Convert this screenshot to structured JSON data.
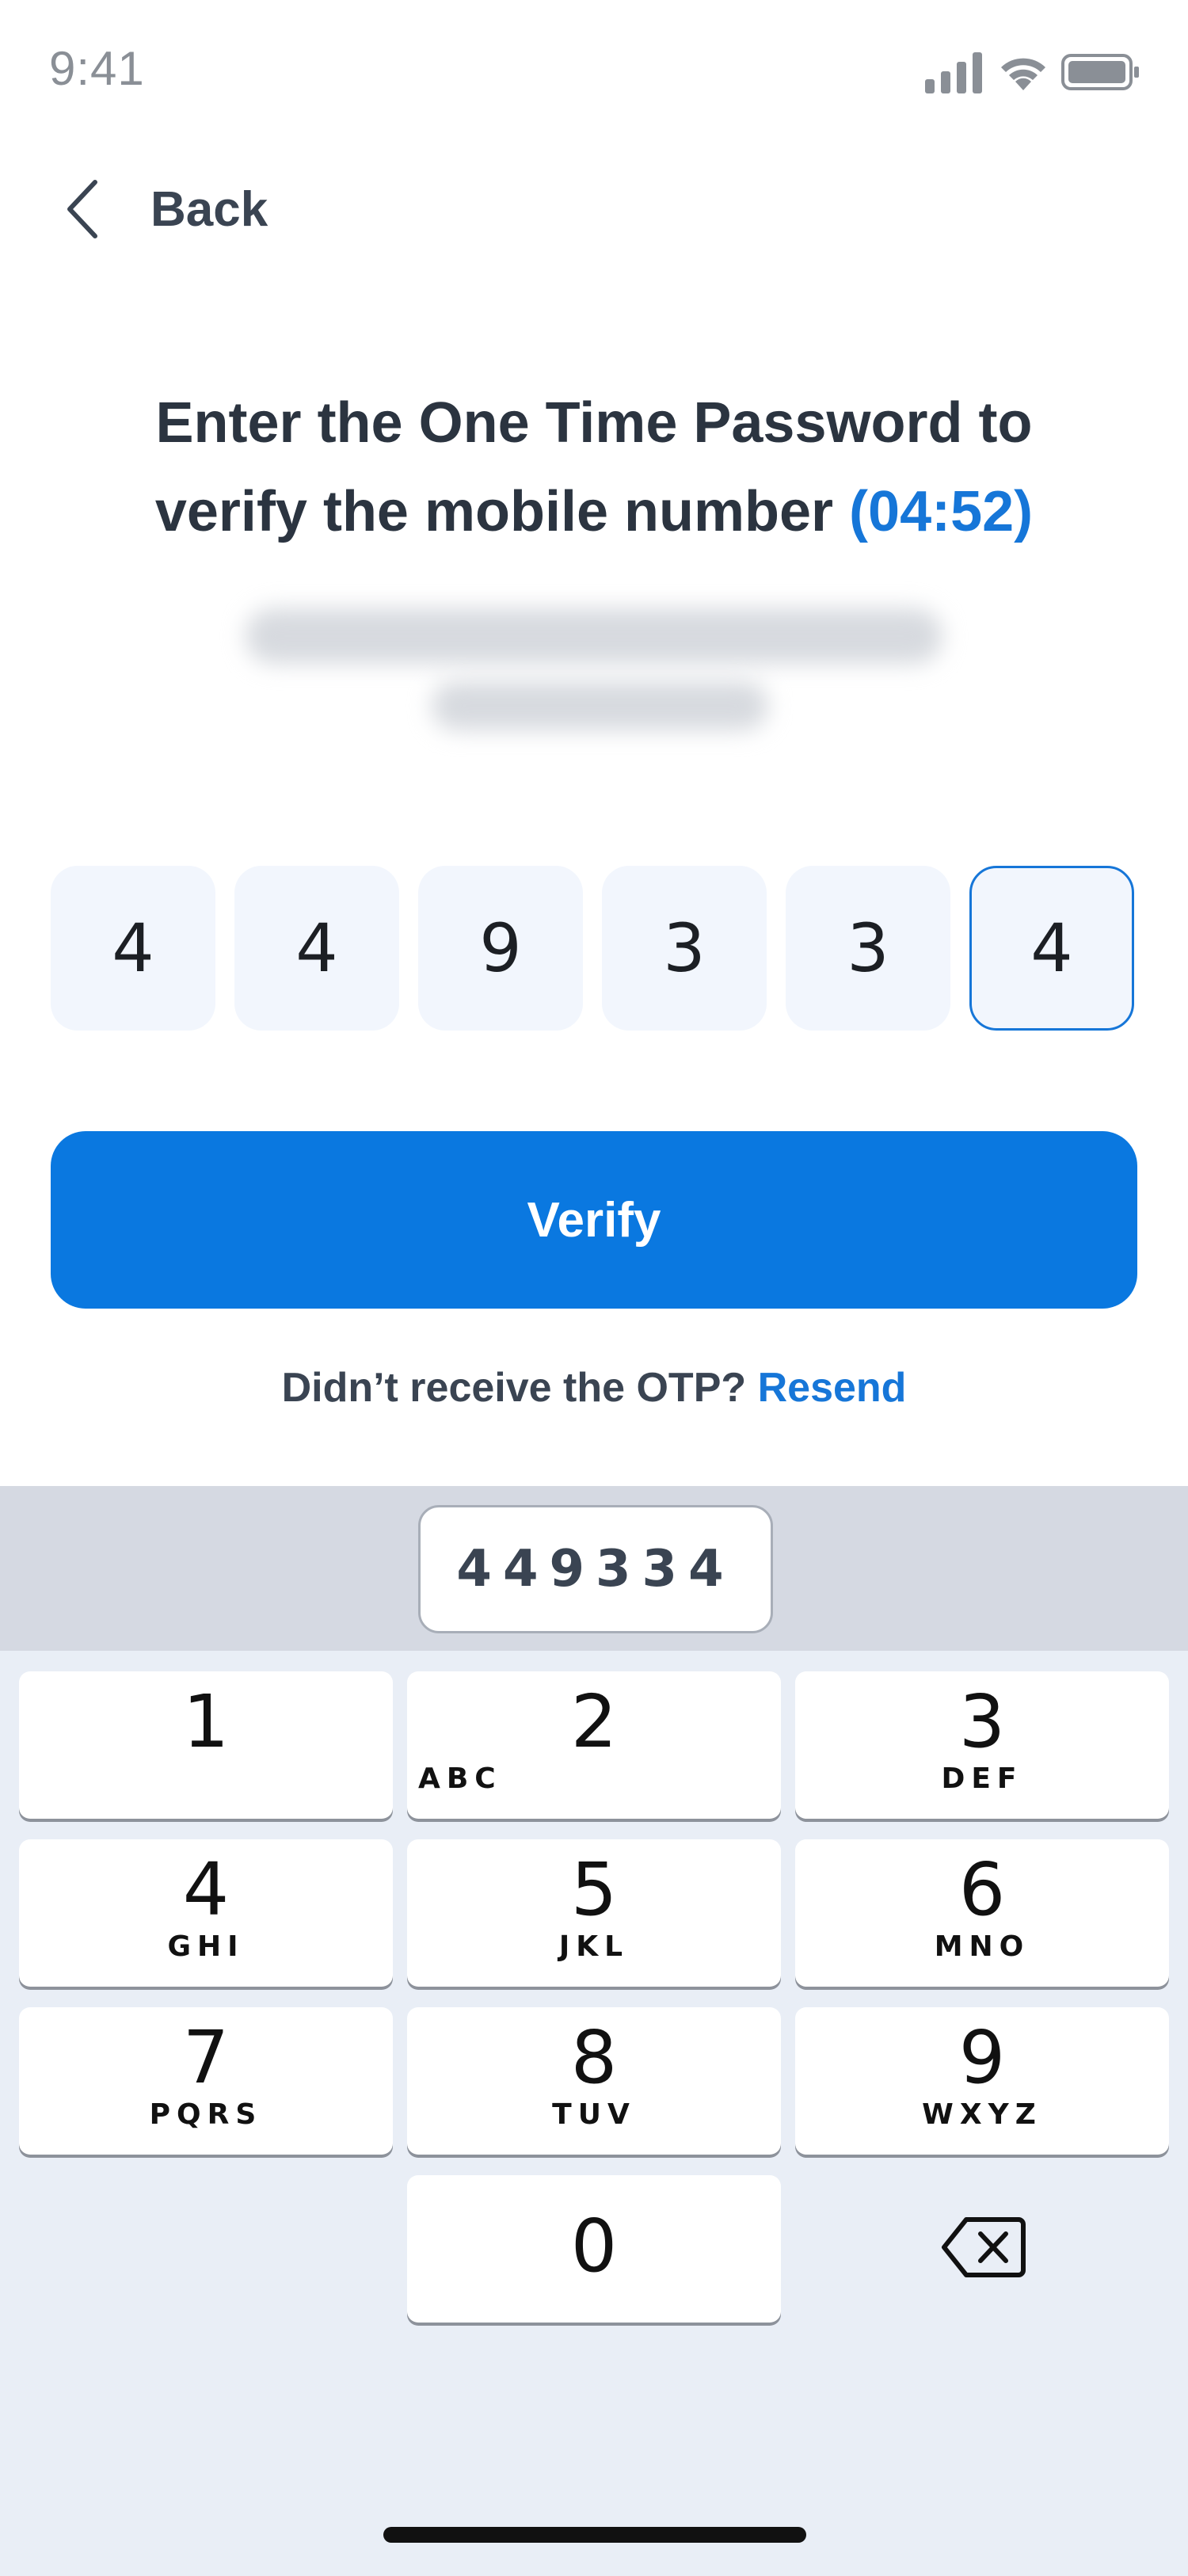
{
  "status_bar": {
    "time": "9:41"
  },
  "nav": {
    "back_label": "Back"
  },
  "header": {
    "title_line1": "Enter the One Time Password to",
    "title_line2": "verify the mobile number",
    "timer": "(04:52)"
  },
  "otp": {
    "digits": [
      "4",
      "4",
      "9",
      "3",
      "3",
      "4"
    ]
  },
  "actions": {
    "verify_label": "Verify",
    "resend_prompt": "Didn’t receive the OTP?",
    "resend_label": "Resend"
  },
  "keyboard": {
    "suggestion": "449334",
    "keys": [
      {
        "digit": "1",
        "letters": ""
      },
      {
        "digit": "2",
        "letters": "ABC"
      },
      {
        "digit": "3",
        "letters": "DEF"
      },
      {
        "digit": "4",
        "letters": "GHI"
      },
      {
        "digit": "5",
        "letters": "JKL"
      },
      {
        "digit": "6",
        "letters": "MNO"
      },
      {
        "digit": "7",
        "letters": "PQRS"
      },
      {
        "digit": "8",
        "letters": "TUV"
      },
      {
        "digit": "9",
        "letters": "WXYZ"
      },
      {
        "digit": "0",
        "letters": ""
      }
    ],
    "delete_icon": "backspace-icon"
  },
  "colors": {
    "accent": "#0a78e0",
    "link": "#1676d8",
    "otp_bg": "#f2f6fd"
  }
}
